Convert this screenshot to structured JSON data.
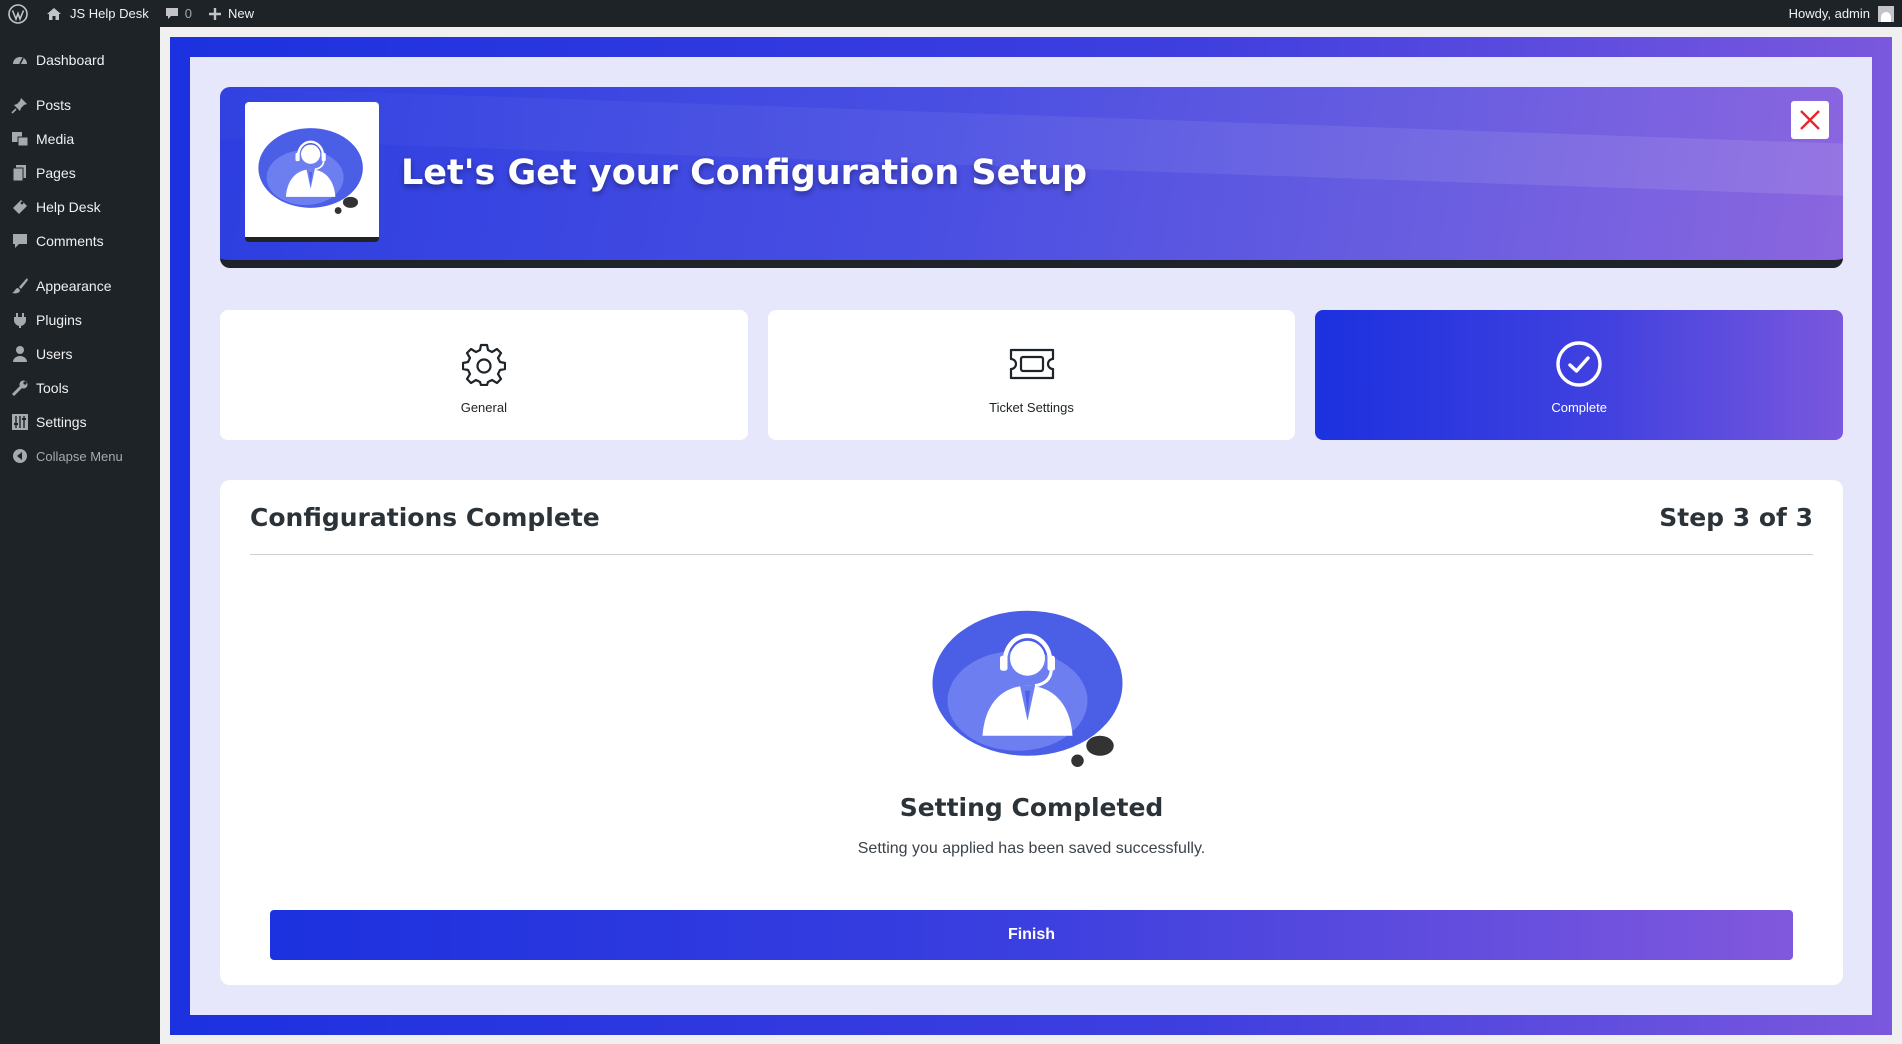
{
  "adminbar": {
    "site_name": "JS Help Desk",
    "comments_count": "0",
    "new_label": "New",
    "howdy": "Howdy, admin"
  },
  "sidebar": {
    "items": [
      {
        "label": "Dashboard",
        "icon": "dashboard-icon"
      },
      {
        "label": "Posts",
        "icon": "pin-icon"
      },
      {
        "label": "Media",
        "icon": "media-icon"
      },
      {
        "label": "Pages",
        "icon": "pages-icon"
      },
      {
        "label": "Help Desk",
        "icon": "ticket-icon"
      },
      {
        "label": "Comments",
        "icon": "comment-icon"
      },
      {
        "label": "Appearance",
        "icon": "brush-icon"
      },
      {
        "label": "Plugins",
        "icon": "plug-icon"
      },
      {
        "label": "Users",
        "icon": "user-icon"
      },
      {
        "label": "Tools",
        "icon": "wrench-icon"
      },
      {
        "label": "Settings",
        "icon": "sliders-icon"
      }
    ],
    "collapse_label": "Collapse Menu"
  },
  "banner": {
    "title": "Let's Get your Configuration Setup"
  },
  "steps": [
    {
      "label": "General",
      "icon": "gear-icon",
      "active": false
    },
    {
      "label": "Ticket Settings",
      "icon": "ticket-icon",
      "active": false
    },
    {
      "label": "Complete",
      "icon": "check-circle-icon",
      "active": true
    }
  ],
  "content": {
    "title": "Configurations Complete",
    "step_indicator": "Step 3 of 3",
    "done_title": "Setting Completed",
    "done_message": "Setting you applied has been saved successfully.",
    "finish_label": "Finish"
  },
  "colors": {
    "accent_start": "#1c31df",
    "accent_end": "#7a58dd",
    "panel_bg": "#e6e7fb",
    "admin_dark": "#1d2327",
    "close_red": "#e8262c"
  }
}
